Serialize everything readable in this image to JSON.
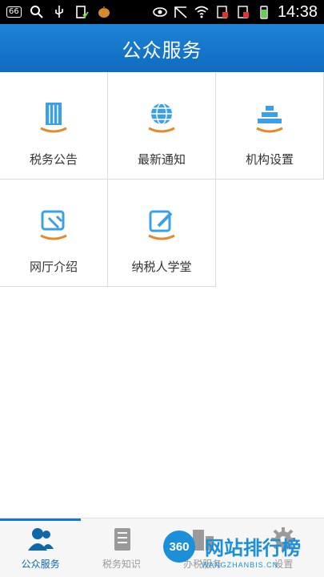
{
  "status_bar": {
    "badge": "66",
    "time": "14:38",
    "icons": [
      "search-icon",
      "usb-icon",
      "sd-card-icon",
      "onion-icon",
      "eye-icon",
      "mute-icon",
      "wifi-icon",
      "sim-icon",
      "sim2-icon",
      "battery-icon"
    ]
  },
  "header": {
    "title": "公众服务"
  },
  "grid": [
    {
      "label": "税务公告",
      "icon": "building-icon"
    },
    {
      "label": "最新通知",
      "icon": "globe-icon"
    },
    {
      "label": "机构设置",
      "icon": "pyramid-icon"
    },
    {
      "label": "网厅介绍",
      "icon": "tools-icon"
    },
    {
      "label": "纳税人学堂",
      "icon": "pencil-pad-icon"
    }
  ],
  "bottom_nav": [
    {
      "label": "公众服务",
      "icon": "users-icon",
      "active": true
    },
    {
      "label": "税务知识",
      "icon": "book-icon",
      "active": false
    },
    {
      "label": "办税服务",
      "icon": "building-icon",
      "active": false
    },
    {
      "label": "设置",
      "icon": "gear-icon",
      "active": false
    }
  ],
  "watermark": {
    "badge": "360",
    "text": "网站排行榜",
    "sub": "WANGZHANBIS.CN"
  },
  "colors": {
    "header": "#1574c8",
    "accent": "#1a79c8",
    "icon_blue": "#3ba0e6",
    "icon_orange": "#e58a2b"
  }
}
